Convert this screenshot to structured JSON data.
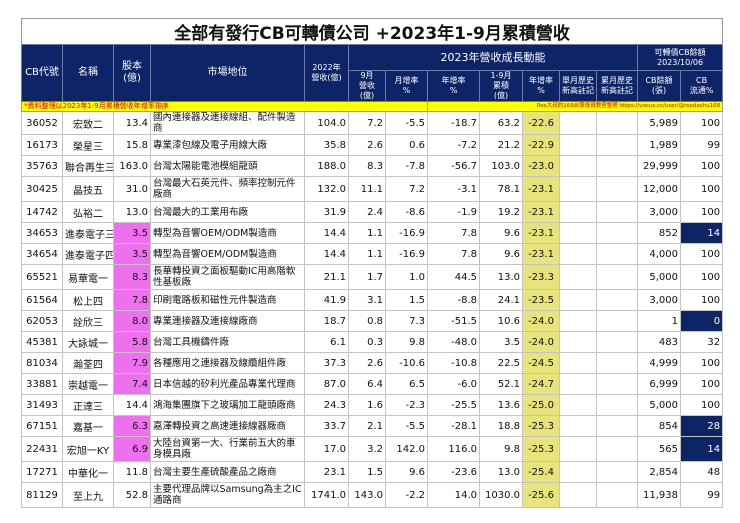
{
  "title": "全部有發行CB可轉債公司 +2023年1-9月累積營收",
  "headers": {
    "code": "CB代號",
    "name": "名稱",
    "capital": "股本\n(億)",
    "market": "市場地位",
    "rev2022": "2022年\n營收(億)",
    "group": "2023年營收成長動能",
    "cbgroup": "可轉債CB餘額\n2023/10/06",
    "sep": "9月\n營收\n(億)",
    "mom": "月增率\n%",
    "yoy": "年增率\n%",
    "ytd": "1-9月\n累積\n(億)",
    "ytdyoy": "年增率\n%",
    "monthhigh": "單月歷史\n新高註記",
    "cumhigh": "累月歷史\n新高註記",
    "cbbal": "CB餘額\n(張)",
    "cbpct": "CB\n流通%"
  },
  "note": "*資料整理以2023年1-9月累積營收年增率排序",
  "note_right": "Rex大叔的168台股投資教室整理 https://vocus.cc/user/@rexdashu168",
  "colors": {
    "navy": "#0d2466",
    "pink": "#ee70ee",
    "yellow": "#e8e47c",
    "note": "#ffff00"
  },
  "rows": [
    {
      "code": "36052",
      "name": "宏致二",
      "capital": "13.4",
      "market": "國內連接器及連接線組、配件製造商",
      "rev2022": "104.0",
      "sep": "7.2",
      "mom": "-5.5",
      "yoy": "-18.7",
      "ytd": "63.2",
      "ytdyoy": "-22.6",
      "monthhigh": "",
      "cumhigh": "",
      "cbbal": "5,989",
      "cbpct": "100",
      "pink": false,
      "navy": false,
      "tall": false
    },
    {
      "code": "16173",
      "name": "榮星三",
      "capital": "15.8",
      "market": "專業漆包線及電子用線大廠",
      "rev2022": "35.8",
      "sep": "2.6",
      "mom": "0.6",
      "yoy": "-7.2",
      "ytd": "21.2",
      "ytdyoy": "-22.9",
      "monthhigh": "",
      "cumhigh": "",
      "cbbal": "1,989",
      "cbpct": "99",
      "pink": false,
      "navy": false,
      "tall": false
    },
    {
      "code": "35763",
      "name": "聯合再生三",
      "capital": "163.0",
      "market": "台灣太陽能電池模組龍頭",
      "rev2022": "188.0",
      "sep": "8.3",
      "mom": "-7.8",
      "yoy": "-56.7",
      "ytd": "103.0",
      "ytdyoy": "-23.0",
      "monthhigh": "",
      "cumhigh": "",
      "cbbal": "29,999",
      "cbpct": "100",
      "pink": false,
      "navy": false,
      "tall": false
    },
    {
      "code": "30425",
      "name": "晶技五",
      "capital": "31.0",
      "market": "台灣最大石英元件、頻率控制元件廠商",
      "rev2022": "132.0",
      "sep": "11.1",
      "mom": "7.2",
      "yoy": "-3.1",
      "ytd": "78.1",
      "ytdyoy": "-23.1",
      "monthhigh": "",
      "cumhigh": "",
      "cbbal": "12,000",
      "cbpct": "100",
      "pink": false,
      "navy": false,
      "tall": true
    },
    {
      "code": "14742",
      "name": "弘裕二",
      "capital": "13.0",
      "market": "台灣最大的工業用布廠",
      "rev2022": "31.9",
      "sep": "2.4",
      "mom": "-8.6",
      "yoy": "-1.9",
      "ytd": "19.2",
      "ytdyoy": "-23.1",
      "monthhigh": "",
      "cumhigh": "",
      "cbbal": "3,000",
      "cbpct": "100",
      "pink": false,
      "navy": false,
      "tall": false
    },
    {
      "code": "34653",
      "name": "進泰電子三",
      "capital": "3.5",
      "market": "轉型為音響OEM/ODM製造商",
      "rev2022": "14.4",
      "sep": "1.1",
      "mom": "-16.9",
      "yoy": "7.8",
      "ytd": "9.6",
      "ytdyoy": "-23.1",
      "monthhigh": "",
      "cumhigh": "",
      "cbbal": "852",
      "cbpct": "14",
      "pink": true,
      "navy": true,
      "tall": false
    },
    {
      "code": "34654",
      "name": "進泰電子四",
      "capital": "3.5",
      "market": "轉型為音響OEM/ODM製造商",
      "rev2022": "14.4",
      "sep": "1.1",
      "mom": "-16.9",
      "yoy": "7.8",
      "ytd": "9.6",
      "ytdyoy": "-23.1",
      "monthhigh": "",
      "cumhigh": "",
      "cbbal": "4,000",
      "cbpct": "100",
      "pink": true,
      "navy": false,
      "tall": false
    },
    {
      "code": "65521",
      "name": "易華電一",
      "capital": "8.3",
      "market": "長華轉投資之面板驅動IC用高階軟性基板廠",
      "rev2022": "21.1",
      "sep": "1.7",
      "mom": "1.0",
      "yoy": "44.5",
      "ytd": "13.0",
      "ytdyoy": "-23.3",
      "monthhigh": "",
      "cumhigh": "",
      "cbbal": "5,000",
      "cbpct": "100",
      "pink": true,
      "navy": false,
      "tall": true
    },
    {
      "code": "61564",
      "name": "松上四",
      "capital": "7.8",
      "market": "印刷電路板和磁性元件製造商",
      "rev2022": "41.9",
      "sep": "3.1",
      "mom": "1.5",
      "yoy": "-8.8",
      "ytd": "24.1",
      "ytdyoy": "-23.5",
      "monthhigh": "",
      "cumhigh": "",
      "cbbal": "3,000",
      "cbpct": "100",
      "pink": true,
      "navy": false,
      "tall": false
    },
    {
      "code": "62053",
      "name": "詮欣三",
      "capital": "8.0",
      "market": "專業連接器及連接線廠商",
      "rev2022": "18.7",
      "sep": "0.8",
      "mom": "7.3",
      "yoy": "-51.5",
      "ytd": "10.6",
      "ytdyoy": "-24.0",
      "monthhigh": "",
      "cumhigh": "",
      "cbbal": "1",
      "cbpct": "0",
      "pink": true,
      "navy": true,
      "tall": false
    },
    {
      "code": "45381",
      "name": "大詠城一",
      "capital": "5.8",
      "market": "台灣工具機鑄件廠",
      "rev2022": "6.1",
      "sep": "0.3",
      "mom": "9.8",
      "yoy": "-48.0",
      "ytd": "3.5",
      "ytdyoy": "-24.0",
      "monthhigh": "",
      "cumhigh": "",
      "cbbal": "483",
      "cbpct": "32",
      "pink": true,
      "navy": false,
      "tall": false
    },
    {
      "code": "81034",
      "name": "瀚荃四",
      "capital": "7.9",
      "market": "各種應用之連接器及線纜組件廠",
      "rev2022": "37.3",
      "sep": "2.6",
      "mom": "-10.6",
      "yoy": "-10.8",
      "ytd": "22.5",
      "ytdyoy": "-24.5",
      "monthhigh": "",
      "cumhigh": "",
      "cbbal": "4,999",
      "cbpct": "100",
      "pink": true,
      "navy": false,
      "tall": false
    },
    {
      "code": "33881",
      "name": "崇越電一",
      "capital": "7.4",
      "market": "日本信越的矽利光產品專業代理商",
      "rev2022": "87.0",
      "sep": "6.4",
      "mom": "6.5",
      "yoy": "-6.0",
      "ytd": "52.1",
      "ytdyoy": "-24.7",
      "monthhigh": "",
      "cumhigh": "",
      "cbbal": "6,999",
      "cbpct": "100",
      "pink": true,
      "navy": false,
      "tall": false
    },
    {
      "code": "31493",
      "name": "正達三",
      "capital": "14.4",
      "market": "鴻海集團旗下之玻璃加工龍頭廠商",
      "rev2022": "24.3",
      "sep": "1.6",
      "mom": "-2.3",
      "yoy": "-25.5",
      "ytd": "13.6",
      "ytdyoy": "-25.0",
      "monthhigh": "",
      "cumhigh": "",
      "cbbal": "5,000",
      "cbpct": "100",
      "pink": false,
      "navy": false,
      "tall": false
    },
    {
      "code": "67151",
      "name": "嘉基一",
      "capital": "6.3",
      "market": "嘉澤轉投資之高速連接線器廠商",
      "rev2022": "33.7",
      "sep": "2.1",
      "mom": "-5.5",
      "yoy": "-28.1",
      "ytd": "18.8",
      "ytdyoy": "-25.3",
      "monthhigh": "",
      "cumhigh": "",
      "cbbal": "854",
      "cbpct": "28",
      "pink": true,
      "navy": true,
      "tall": false
    },
    {
      "code": "22431",
      "name": "宏旭一KY",
      "capital": "6.9",
      "market": "大陸台資第一大、行業前五大的車身模具廠",
      "rev2022": "17.0",
      "sep": "3.2",
      "mom": "142.0",
      "yoy": "116.0",
      "ytd": "9.8",
      "ytdyoy": "-25.3",
      "monthhigh": "",
      "cumhigh": "",
      "cbbal": "565",
      "cbpct": "14",
      "pink": true,
      "navy": true,
      "tall": true
    },
    {
      "code": "17271",
      "name": "中華化一",
      "capital": "11.8",
      "market": "台灣主要生產硫酸產品之廠商",
      "rev2022": "23.1",
      "sep": "1.5",
      "mom": "9.6",
      "yoy": "-23.6",
      "ytd": "13.0",
      "ytdyoy": "-25.4",
      "monthhigh": "",
      "cumhigh": "",
      "cbbal": "2,854",
      "cbpct": "48",
      "pink": false,
      "navy": false,
      "tall": false
    },
    {
      "code": "81129",
      "name": "至上九",
      "capital": "52.8",
      "market": "主要代理品牌以Samsung為主之IC通路商",
      "rev2022": "1741.0",
      "sep": "143.0",
      "mom": "-2.2",
      "yoy": "14.0",
      "ytd": "1030.0",
      "ytdyoy": "-25.6",
      "monthhigh": "",
      "cumhigh": "",
      "cbbal": "11,938",
      "cbpct": "99",
      "pink": false,
      "navy": false,
      "tall": true
    }
  ]
}
